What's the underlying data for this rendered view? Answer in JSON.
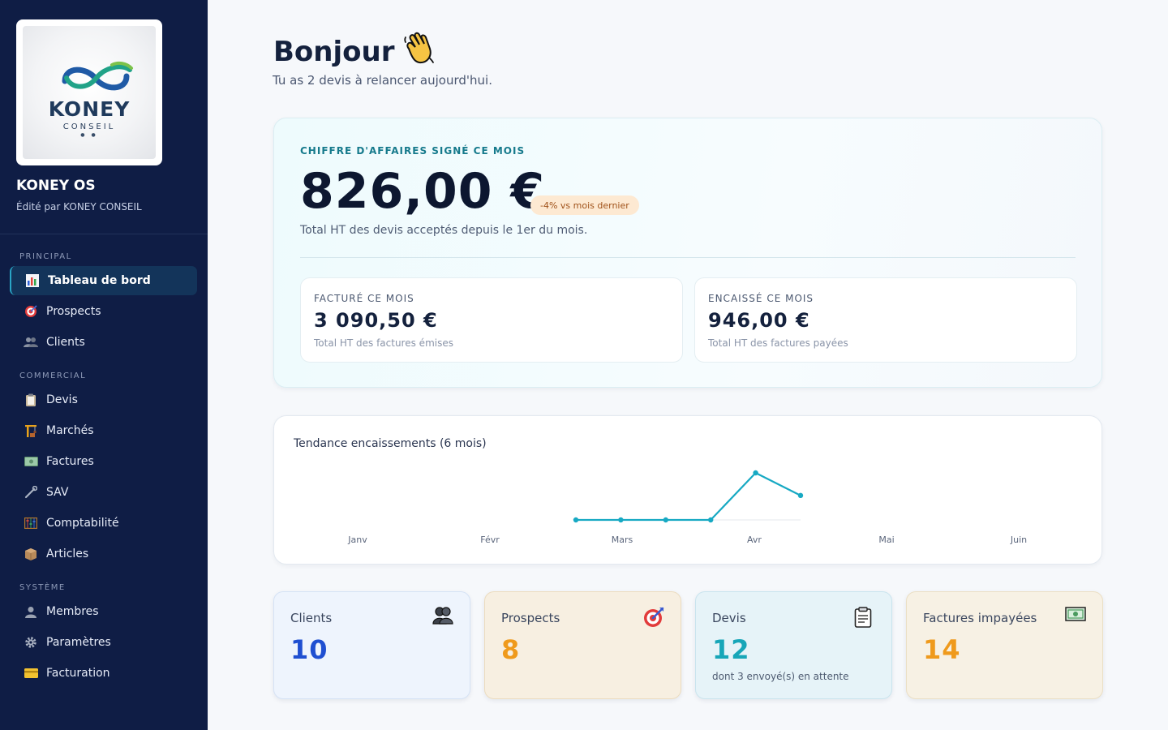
{
  "sidebar": {
    "logo": {
      "word": "KONEY",
      "sub": "CONSEIL"
    },
    "app_name": "KONEY OS",
    "app_sub": "Édité par KONEY CONSEIL",
    "sections": {
      "principal": "PRINCIPAL",
      "commercial": "COMMERCIAL",
      "systeme": "SYSTÈME"
    },
    "items": [
      {
        "label": "Tableau de bord",
        "icon": "bar-chart-icon",
        "active": true
      },
      {
        "label": "Prospects",
        "icon": "target-icon"
      },
      {
        "label": "Clients",
        "icon": "users-icon"
      },
      {
        "label": "Devis",
        "icon": "clipboard-icon"
      },
      {
        "label": "Marchés",
        "icon": "crane-icon"
      },
      {
        "label": "Factures",
        "icon": "banknote-icon"
      },
      {
        "label": "SAV",
        "icon": "wrench-icon"
      },
      {
        "label": "Comptabilité",
        "icon": "abacus-icon"
      },
      {
        "label": "Articles",
        "icon": "box-icon"
      },
      {
        "label": "Membres",
        "icon": "user-icon"
      },
      {
        "label": "Paramètres",
        "icon": "gear-icon"
      },
      {
        "label": "Facturation",
        "icon": "credit-card-icon"
      }
    ]
  },
  "header": {
    "greeting": "Bonjour",
    "wave_icon": "waving-hand-icon",
    "subline": "Tu as 2 devis à relancer aujourd'hui."
  },
  "revenue": {
    "label": "CHIFFRE D'AFFAIRES SIGNÉ CE MOIS",
    "value": "826,00 €",
    "badge": "-4% vs mois dernier",
    "desc": "Total HT des devis acceptés depuis le 1er du mois.",
    "invoiced": {
      "label": "FACTURÉ CE MOIS",
      "value": "3 090,50 €",
      "desc": "Total HT des factures émises"
    },
    "cashed": {
      "label": "ENCAISSÉ CE MOIS",
      "value": "946,00 €",
      "desc": "Total HT des factures payées"
    }
  },
  "trend": {
    "title": "Tendance encaissements (6 mois)"
  },
  "chart_data": {
    "type": "line",
    "title": "Tendance encaissements (6 mois)",
    "categories": [
      "Janv",
      "Févr",
      "Mars",
      "Avr",
      "Mai",
      "Juin"
    ],
    "x": [
      0,
      1,
      2,
      3,
      4,
      5
    ],
    "values": [
      0,
      0,
      0,
      0,
      1000,
      520
    ],
    "ylim": [
      0,
      1000
    ],
    "grid": false,
    "color": "#17a9c3"
  },
  "stats": [
    {
      "label": "Clients",
      "value": "10",
      "desc": "",
      "icon": "users-icon",
      "bg": "#eef4fd",
      "border": "#d5e2f5",
      "color": "#1f4fd1"
    },
    {
      "label": "Prospects",
      "value": "8",
      "desc": "",
      "icon": "target-icon",
      "bg": "#f7efe1",
      "border": "#ecdcbf",
      "color": "#ef9a1c"
    },
    {
      "label": "Devis",
      "value": "12",
      "desc": "dont 3 envoyé(s) en attente",
      "icon": "clipboard-icon",
      "bg": "#e6f3f8",
      "border": "#c9e4ee",
      "color": "#17a6b8"
    },
    {
      "label": "Factures impayées",
      "value": "14",
      "desc": "",
      "icon": "banknote-icon",
      "bg": "#f7f1e4",
      "border": "#ebdfc4",
      "color": "#ef9a1c"
    }
  ]
}
